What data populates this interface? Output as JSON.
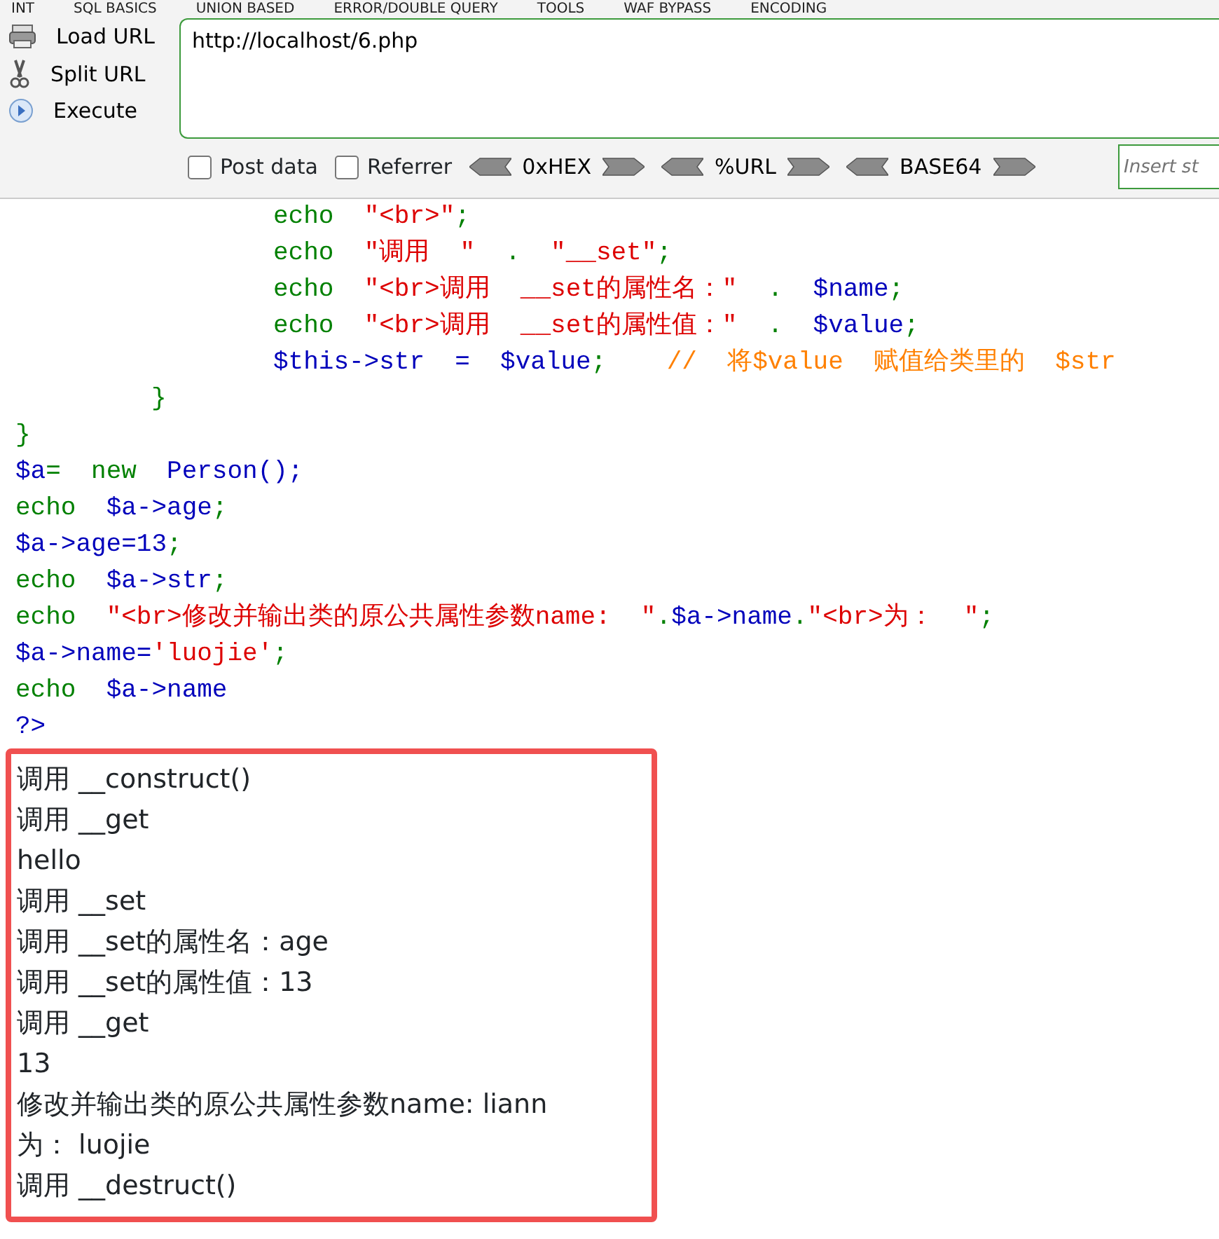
{
  "menu": [
    "INT",
    "SQL BASICS",
    "UNION BASED",
    "ERROR/DOUBLE QUERY",
    "TOOLS",
    "WAF BYPASS",
    "ENCODING"
  ],
  "actions": [
    {
      "kind": "load",
      "label": "Load URL"
    },
    {
      "kind": "split",
      "label": "Split URL"
    },
    {
      "kind": "execute",
      "label": "Execute"
    }
  ],
  "url": {
    "value": "http://localhost/6.php"
  },
  "options": [
    {
      "label": "Post data",
      "checked": false
    },
    {
      "label": "Referrer",
      "checked": false
    }
  ],
  "encoders": [
    "0xHEX",
    "%URL",
    "BASE64"
  ],
  "insert": {
    "placeholder": "Insert st"
  },
  "code": [
    {
      "kind": "body",
      "tokens": [
        {
          "kind": "kw",
          "text": "echo  "
        },
        {
          "kind": "str",
          "text": "\"<br>\""
        },
        {
          "kind": "kw",
          "text": ";"
        }
      ]
    },
    {
      "kind": "body",
      "tokens": [
        {
          "kind": "kw",
          "text": "echo  "
        },
        {
          "kind": "str",
          "text": "\"调用  \""
        },
        {
          "kind": "kw",
          "text": "  .  "
        },
        {
          "kind": "str",
          "text": "\"__set\""
        },
        {
          "kind": "kw",
          "text": ";"
        }
      ]
    },
    {
      "kind": "body",
      "tokens": [
        {
          "kind": "kw",
          "text": "echo  "
        },
        {
          "kind": "str",
          "text": "\"<br>调用  __set的属性名：\""
        },
        {
          "kind": "kw",
          "text": "  .  "
        },
        {
          "kind": "var",
          "text": "$name"
        },
        {
          "kind": "kw",
          "text": ";"
        }
      ]
    },
    {
      "kind": "body",
      "tokens": [
        {
          "kind": "kw",
          "text": "echo  "
        },
        {
          "kind": "str",
          "text": "\"<br>调用  __set的属性值：\""
        },
        {
          "kind": "kw",
          "text": "  .  "
        },
        {
          "kind": "var",
          "text": "$value"
        },
        {
          "kind": "kw",
          "text": ";"
        }
      ]
    },
    {
      "kind": "body",
      "tokens": [
        {
          "kind": "var",
          "text": "$this->str  =  $value"
        },
        {
          "kind": "kw",
          "text": ";    "
        },
        {
          "kind": "com",
          "text": "//  将$value  赋值给类里的  $str"
        }
      ]
    },
    {
      "kind": "method",
      "tokens": [
        {
          "kind": "kw",
          "text": "}"
        }
      ]
    },
    {
      "kind": "top",
      "tokens": [
        {
          "kind": "kw",
          "text": "}"
        }
      ]
    },
    {
      "kind": "top",
      "tokens": [
        {
          "kind": "var",
          "text": "$a"
        },
        {
          "kind": "kw",
          "text": "=  new  "
        },
        {
          "kind": "var",
          "text": "Person();"
        }
      ]
    },
    {
      "kind": "top",
      "tokens": [
        {
          "kind": "kw",
          "text": "echo  "
        },
        {
          "kind": "var",
          "text": "$a->age"
        },
        {
          "kind": "kw",
          "text": ";"
        }
      ]
    },
    {
      "kind": "top",
      "tokens": [
        {
          "kind": "var",
          "text": "$a->age=13"
        },
        {
          "kind": "kw",
          "text": ";"
        }
      ]
    },
    {
      "kind": "top",
      "tokens": [
        {
          "kind": "kw",
          "text": "echo  "
        },
        {
          "kind": "var",
          "text": "$a->str"
        },
        {
          "kind": "kw",
          "text": ";"
        }
      ]
    },
    {
      "kind": "top",
      "tokens": [
        {
          "kind": "kw",
          "text": "echo  "
        },
        {
          "kind": "str",
          "text": "\"<br>修改并输出类的原公共属性参数name:  \""
        },
        {
          "kind": "kw",
          "text": "."
        },
        {
          "kind": "var",
          "text": "$a->name"
        },
        {
          "kind": "kw",
          "text": "."
        },
        {
          "kind": "str",
          "text": "\"<br>为：  \""
        },
        {
          "kind": "kw",
          "text": ";"
        }
      ]
    },
    {
      "kind": "top",
      "tokens": [
        {
          "kind": "var",
          "text": "$a->name="
        },
        {
          "kind": "str",
          "text": "'luojie'"
        },
        {
          "kind": "kw",
          "text": ";"
        }
      ]
    },
    {
      "kind": "top",
      "tokens": [
        {
          "kind": "kw",
          "text": "echo  "
        },
        {
          "kind": "var",
          "text": "$a->name"
        }
      ]
    },
    {
      "kind": "top",
      "tokens": [
        {
          "kind": "var",
          "text": "?>"
        }
      ]
    }
  ],
  "output": [
    "调用 __construct()",
    "调用 __get",
    "hello",
    "调用 __set",
    "调用 __set的属性名：age",
    "调用 __set的属性值：13",
    "调用 __get",
    "13",
    "修改并输出类的原公共属性参数name: liann",
    "为： luojie",
    "调用 __destruct()"
  ]
}
